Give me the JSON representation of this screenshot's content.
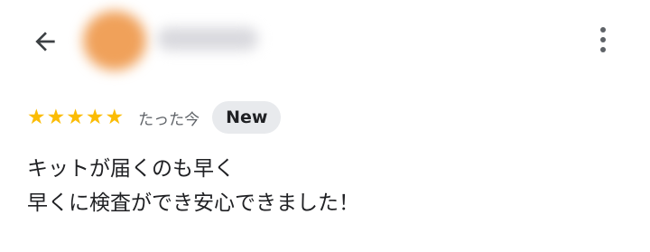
{
  "header": {
    "back_icon": "arrow-back-icon",
    "avatar_color": "#f0a15a",
    "author_name": "",
    "more_icon": "more-vert-icon"
  },
  "review": {
    "rating": 5,
    "rating_max": 5,
    "star_color": "#fbbc04",
    "time": "たった今",
    "badge": "New",
    "lines": [
      "キットが届くのも早く",
      "早くに検査ができ安心できました！"
    ]
  }
}
